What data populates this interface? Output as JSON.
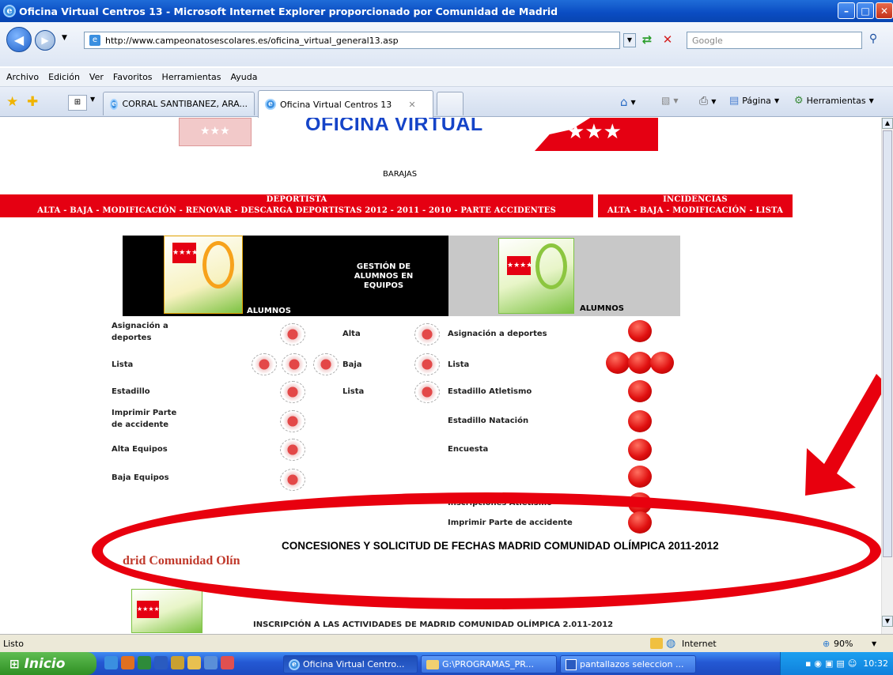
{
  "window": {
    "title": "Oficina Virtual Centros 13 - Microsoft Internet Explorer proporcionado por Comunidad de Madrid"
  },
  "address": {
    "url": "http://www.campeonatosescolares.es/oficina_virtual_general13.asp",
    "search_placeholder": "Google"
  },
  "menu": [
    "Archivo",
    "Edición",
    "Ver",
    "Favoritos",
    "Herramientas",
    "Ayuda"
  ],
  "tabs": [
    {
      "label": "CORRAL SANTIBANEZ, ARA..."
    },
    {
      "label": "Oficina Virtual Centros 13"
    }
  ],
  "toolbar": {
    "page_label": "Página",
    "tools_label": "Herramientas"
  },
  "page": {
    "banner_title": "OFICINA VIRTUAL",
    "district": "BARAJAS",
    "deportista": {
      "header": "DEPORTISTA",
      "links": "ALTA - BAJA - MODIFICACIÓN - RENOVAR - DESCARGA DEPORTISTAS 2012 - 2011 - 2010 - PARTE ACCIDENTES"
    },
    "incidencias": {
      "header": "INCIDENCIAS",
      "links": "ALTA - BAJA - MODIFICACIÓN - LISTA"
    },
    "left_panel": {
      "caption": "ALUMNOS"
    },
    "middle_panel": {
      "title": "GESTIÓN DE ALUMNOS EN EQUIPOS"
    },
    "right_panel": {
      "caption": "ALUMNOS"
    },
    "left_items": [
      "Asignación a deportes",
      "Lista",
      "Estadillo",
      "Imprimir Parte de accidente",
      "Alta Equipos",
      "Baja Equipos"
    ],
    "middle_items": [
      "Alta",
      "Baja",
      "Lista"
    ],
    "right_items": [
      "Asignación a deportes",
      "Lista",
      "Estadillo Atletismo",
      "Estadillo Natación",
      "Encuesta",
      "Inscripciones Atletismo",
      "Imprimir Parte de accidente"
    ],
    "concesiones": "CONCESIONES Y SOLICITUD DE FECHAS MADRID COMUNIDAD OLÍMPICA 2011-2012",
    "mco_title": "drid Comunidad Olín",
    "inscripcion": "INSCRIPCIÓN A LAS ACTIVIDADES DE MADRID COMUNIDAD OLÍMPICA 2.011-2012"
  },
  "status": {
    "text": "Listo",
    "zone": "Internet",
    "zoom": "90%"
  },
  "taskbar": {
    "start": "Inicio",
    "items": [
      "Oficina Virtual Centro...",
      "G:\\PROGRAMAS_PR...",
      "pantallazos seleccion ..."
    ],
    "clock": "10:32"
  },
  "colors": {
    "accent_red": "#e50012",
    "ie_blue": "#0a4cc2"
  }
}
